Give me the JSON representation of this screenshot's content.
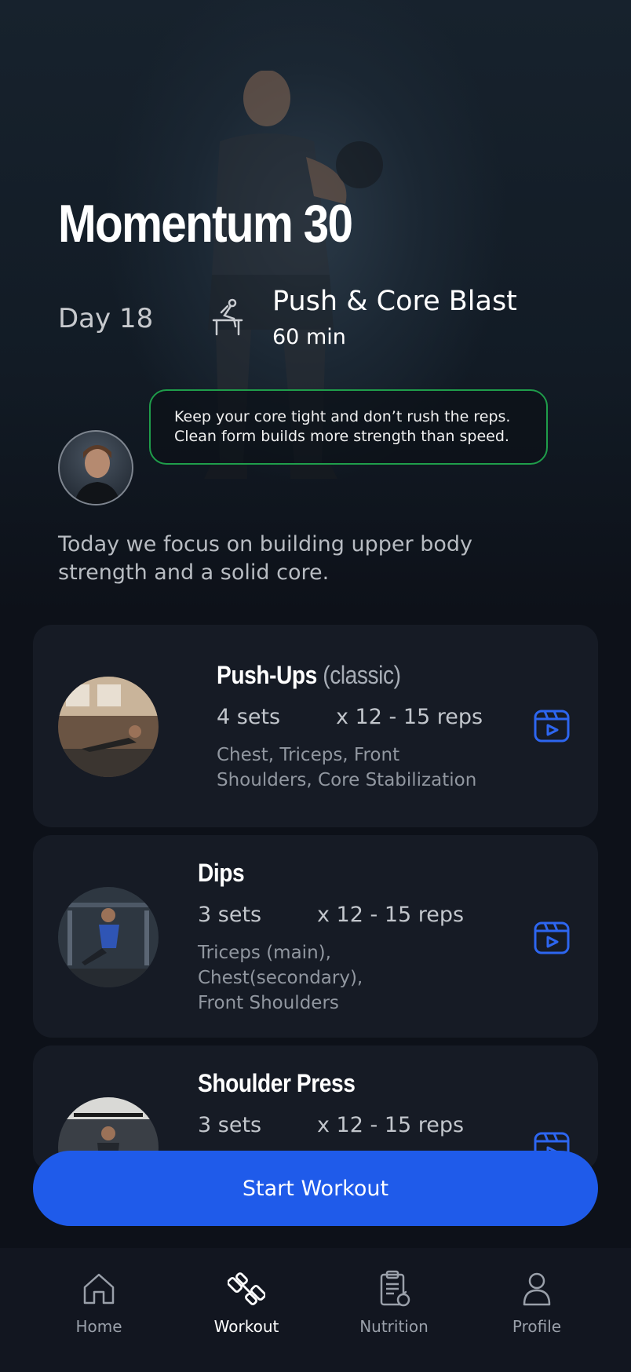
{
  "program": {
    "title": "Momentum 30",
    "day": "Day 18"
  },
  "workout": {
    "name": "Push & Core Blast",
    "duration": "60 min",
    "icon": "weight-bench-icon"
  },
  "coach": {
    "tip": "Keep your core tight and don’t rush the reps. Clean form builds more strength than speed.",
    "intro": "Today we focus on building upper body strength and a solid core."
  },
  "exercises": [
    {
      "name": "Push-Ups",
      "qualifier": "(classic)",
      "sets": "4 sets",
      "reps": "x 12 - 15 reps",
      "muscles": "Chest, Triceps, Front Shoulders, Core Stabilization",
      "video_icon": "video-play-icon"
    },
    {
      "name": "Dips",
      "qualifier": "",
      "sets": "3 sets",
      "reps": "x 12 - 15 reps",
      "muscles": "Triceps (main), Chest(secondary), Front Shoulders",
      "video_icon": "video-play-icon"
    },
    {
      "name": "Shoulder Press",
      "qualifier": "",
      "sets": "3 sets",
      "reps": "x 12 - 15 reps",
      "muscles": "",
      "video_icon": "video-play-icon"
    }
  ],
  "actions": {
    "start_label": "Start Workout"
  },
  "tabs": [
    {
      "label": "Home",
      "icon": "home-icon",
      "active": false
    },
    {
      "label": "Workout",
      "icon": "dumbbell-icon",
      "active": true
    },
    {
      "label": "Nutrition",
      "icon": "clipboard-apple-icon",
      "active": false
    },
    {
      "label": "Profile",
      "icon": "user-icon",
      "active": false
    }
  ],
  "colors": {
    "accent": "#1f5bea",
    "tip_border": "#1f9d4a",
    "card": "#161b25",
    "background": "#0d1119"
  }
}
